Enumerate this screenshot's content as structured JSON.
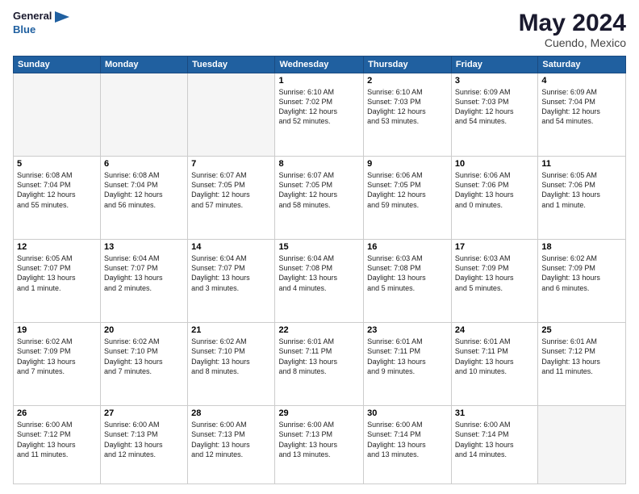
{
  "header": {
    "logo_line1": "General",
    "logo_line2": "Blue",
    "title": "May 2024",
    "subtitle": "Cuendo, Mexico"
  },
  "weekdays": [
    "Sunday",
    "Monday",
    "Tuesday",
    "Wednesday",
    "Thursday",
    "Friday",
    "Saturday"
  ],
  "weeks": [
    [
      {
        "day": "",
        "info": ""
      },
      {
        "day": "",
        "info": ""
      },
      {
        "day": "",
        "info": ""
      },
      {
        "day": "1",
        "info": "Sunrise: 6:10 AM\nSunset: 7:02 PM\nDaylight: 12 hours\nand 52 minutes."
      },
      {
        "day": "2",
        "info": "Sunrise: 6:10 AM\nSunset: 7:03 PM\nDaylight: 12 hours\nand 53 minutes."
      },
      {
        "day": "3",
        "info": "Sunrise: 6:09 AM\nSunset: 7:03 PM\nDaylight: 12 hours\nand 54 minutes."
      },
      {
        "day": "4",
        "info": "Sunrise: 6:09 AM\nSunset: 7:04 PM\nDaylight: 12 hours\nand 54 minutes."
      }
    ],
    [
      {
        "day": "5",
        "info": "Sunrise: 6:08 AM\nSunset: 7:04 PM\nDaylight: 12 hours\nand 55 minutes."
      },
      {
        "day": "6",
        "info": "Sunrise: 6:08 AM\nSunset: 7:04 PM\nDaylight: 12 hours\nand 56 minutes."
      },
      {
        "day": "7",
        "info": "Sunrise: 6:07 AM\nSunset: 7:05 PM\nDaylight: 12 hours\nand 57 minutes."
      },
      {
        "day": "8",
        "info": "Sunrise: 6:07 AM\nSunset: 7:05 PM\nDaylight: 12 hours\nand 58 minutes."
      },
      {
        "day": "9",
        "info": "Sunrise: 6:06 AM\nSunset: 7:05 PM\nDaylight: 12 hours\nand 59 minutes."
      },
      {
        "day": "10",
        "info": "Sunrise: 6:06 AM\nSunset: 7:06 PM\nDaylight: 13 hours\nand 0 minutes."
      },
      {
        "day": "11",
        "info": "Sunrise: 6:05 AM\nSunset: 7:06 PM\nDaylight: 13 hours\nand 1 minute."
      }
    ],
    [
      {
        "day": "12",
        "info": "Sunrise: 6:05 AM\nSunset: 7:07 PM\nDaylight: 13 hours\nand 1 minute."
      },
      {
        "day": "13",
        "info": "Sunrise: 6:04 AM\nSunset: 7:07 PM\nDaylight: 13 hours\nand 2 minutes."
      },
      {
        "day": "14",
        "info": "Sunrise: 6:04 AM\nSunset: 7:07 PM\nDaylight: 13 hours\nand 3 minutes."
      },
      {
        "day": "15",
        "info": "Sunrise: 6:04 AM\nSunset: 7:08 PM\nDaylight: 13 hours\nand 4 minutes."
      },
      {
        "day": "16",
        "info": "Sunrise: 6:03 AM\nSunset: 7:08 PM\nDaylight: 13 hours\nand 5 minutes."
      },
      {
        "day": "17",
        "info": "Sunrise: 6:03 AM\nSunset: 7:09 PM\nDaylight: 13 hours\nand 5 minutes."
      },
      {
        "day": "18",
        "info": "Sunrise: 6:02 AM\nSunset: 7:09 PM\nDaylight: 13 hours\nand 6 minutes."
      }
    ],
    [
      {
        "day": "19",
        "info": "Sunrise: 6:02 AM\nSunset: 7:09 PM\nDaylight: 13 hours\nand 7 minutes."
      },
      {
        "day": "20",
        "info": "Sunrise: 6:02 AM\nSunset: 7:10 PM\nDaylight: 13 hours\nand 7 minutes."
      },
      {
        "day": "21",
        "info": "Sunrise: 6:02 AM\nSunset: 7:10 PM\nDaylight: 13 hours\nand 8 minutes."
      },
      {
        "day": "22",
        "info": "Sunrise: 6:01 AM\nSunset: 7:11 PM\nDaylight: 13 hours\nand 8 minutes."
      },
      {
        "day": "23",
        "info": "Sunrise: 6:01 AM\nSunset: 7:11 PM\nDaylight: 13 hours\nand 9 minutes."
      },
      {
        "day": "24",
        "info": "Sunrise: 6:01 AM\nSunset: 7:11 PM\nDaylight: 13 hours\nand 10 minutes."
      },
      {
        "day": "25",
        "info": "Sunrise: 6:01 AM\nSunset: 7:12 PM\nDaylight: 13 hours\nand 11 minutes."
      }
    ],
    [
      {
        "day": "26",
        "info": "Sunrise: 6:00 AM\nSunset: 7:12 PM\nDaylight: 13 hours\nand 11 minutes."
      },
      {
        "day": "27",
        "info": "Sunrise: 6:00 AM\nSunset: 7:13 PM\nDaylight: 13 hours\nand 12 minutes."
      },
      {
        "day": "28",
        "info": "Sunrise: 6:00 AM\nSunset: 7:13 PM\nDaylight: 13 hours\nand 12 minutes."
      },
      {
        "day": "29",
        "info": "Sunrise: 6:00 AM\nSunset: 7:13 PM\nDaylight: 13 hours\nand 13 minutes."
      },
      {
        "day": "30",
        "info": "Sunrise: 6:00 AM\nSunset: 7:14 PM\nDaylight: 13 hours\nand 13 minutes."
      },
      {
        "day": "31",
        "info": "Sunrise: 6:00 AM\nSunset: 7:14 PM\nDaylight: 13 hours\nand 14 minutes."
      },
      {
        "day": "",
        "info": ""
      }
    ]
  ]
}
